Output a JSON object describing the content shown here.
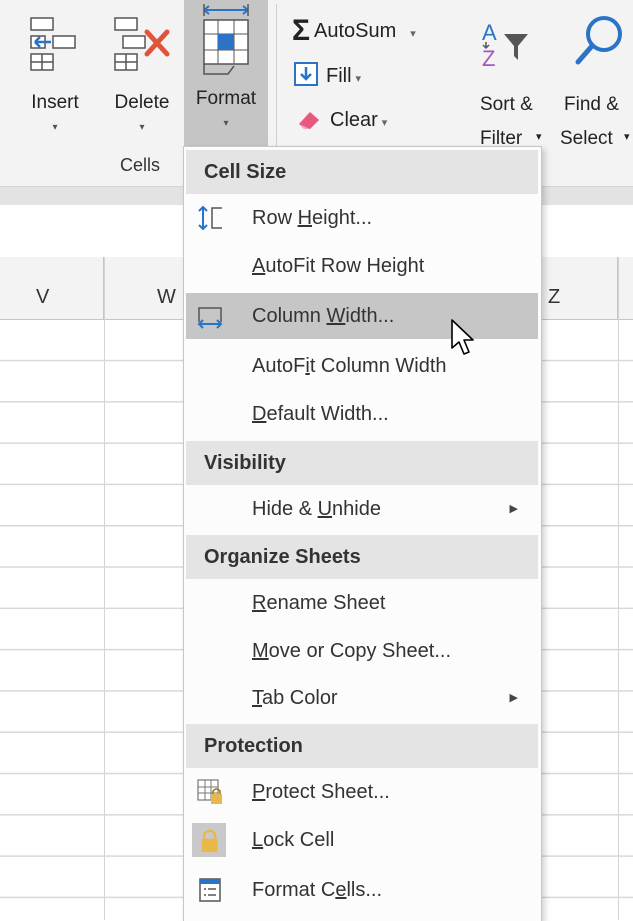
{
  "ribbon": {
    "cells": {
      "insert_label": "Insert",
      "delete_label": "Delete",
      "format_label": "Format",
      "caret": "▾",
      "group_label": "Cells"
    },
    "editing": {
      "autosum_label": "AutoSum",
      "fill_label": "Fill",
      "clear_label": "Clear",
      "dropdown": "▾",
      "sort_label_1": "Sort &",
      "sort_label_2": "Filter",
      "find_label_1": "Find &",
      "find_label_2": "Select"
    }
  },
  "columns": [
    "V",
    "W",
    "Z"
  ],
  "menu": {
    "cell_size_header": "Cell Size",
    "row_height": {
      "pre": "Row ",
      "acc": "H",
      "post": "eight..."
    },
    "autofit_row": {
      "pre": "",
      "acc": "A",
      "post": "utoFit Row Height"
    },
    "column_width": {
      "pre": "Column ",
      "acc": "W",
      "post": "idth..."
    },
    "autofit_col": {
      "pre": "AutoF",
      "acc": "i",
      "post": "t Column Width"
    },
    "default_width": {
      "pre": "",
      "acc": "D",
      "post": "efault Width..."
    },
    "visibility_header": "Visibility",
    "hide_unhide": {
      "pre": "Hide & ",
      "acc": "U",
      "post": "nhide"
    },
    "organize_header": "Organize Sheets",
    "rename_sheet": {
      "pre": "",
      "acc": "R",
      "post": "ename Sheet"
    },
    "move_copy": {
      "pre": "",
      "acc": "M",
      "post": "ove or Copy Sheet..."
    },
    "tab_color": {
      "pre": "",
      "acc": "T",
      "post": "ab Color"
    },
    "protection_header": "Protection",
    "protect_sheet": {
      "pre": "",
      "acc": "P",
      "post": "rotect Sheet..."
    },
    "lock_cell": {
      "pre": "",
      "acc": "L",
      "post": "ock Cell"
    },
    "format_cells": {
      "pre": "Format C",
      "acc": "e",
      "post": "lls..."
    },
    "submenu_arrow": "▶"
  },
  "colors": {
    "highlight": "#c6c6c6",
    "header_bg": "#e4e4e4",
    "delete_x": "#e0543a",
    "blue_icon": "#2b73c6",
    "lock_gold": "#e8b84a"
  }
}
